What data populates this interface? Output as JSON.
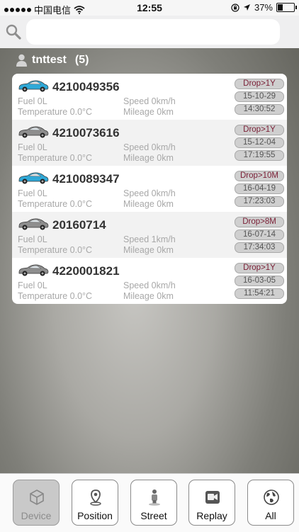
{
  "status_bar": {
    "carrier": "中国电信",
    "time": "12:55",
    "battery": "37%",
    "battery_level": 0.37
  },
  "search": {
    "placeholder": ""
  },
  "group": {
    "name": "tnttest",
    "count": "(5)"
  },
  "devices": [
    {
      "id": "4210049356",
      "car_color": "#2fa9d8",
      "fuel": "Fuel 0L",
      "temperature": "Temperature 0.0°C",
      "speed": "Speed 0km/h",
      "mileage": "Mileage 0km",
      "drop": "Drop>1Y",
      "date": "15-10-29",
      "time": "14:30:52"
    },
    {
      "id": "4210073616",
      "car_color": "#8e8e8e",
      "fuel": "Fuel 0L",
      "temperature": "Temperature 0.0°C",
      "speed": "Speed 0km/h",
      "mileage": "Mileage 0km",
      "drop": "Drop>1Y",
      "date": "15-12-04",
      "time": "17:19:55"
    },
    {
      "id": "4210089347",
      "car_color": "#2fa9d8",
      "fuel": "Fuel 0L",
      "temperature": "Temperature 0.0°C",
      "speed": "Speed 0km/h",
      "mileage": "Mileage 0km",
      "drop": "Drop>10M",
      "date": "16-04-19",
      "time": "17:23:03"
    },
    {
      "id": "20160714",
      "car_color": "#8e8e8e",
      "fuel": "Fuel 0L",
      "temperature": "Temperature 0.0°C",
      "speed": "Speed 1km/h",
      "mileage": "Mileage 0km",
      "drop": "Drop>8M",
      "date": "16-07-14",
      "time": "17:34:03"
    },
    {
      "id": "4220001821",
      "car_color": "#8e8e8e",
      "fuel": "Fuel 0L",
      "temperature": "Temperature 0.0°C",
      "speed": "Speed 0km/h",
      "mileage": "Mileage 0km",
      "drop": "Drop>1Y",
      "date": "16-03-05",
      "time": "11:54:21"
    }
  ],
  "tabs": [
    {
      "label": "Device",
      "icon": "cube-icon",
      "selected": true
    },
    {
      "label": "Position",
      "icon": "location-pin-icon",
      "selected": false
    },
    {
      "label": "Street",
      "icon": "street-person-icon",
      "selected": false
    },
    {
      "label": "Replay",
      "icon": "video-replay-icon",
      "selected": false
    },
    {
      "label": "All",
      "icon": "globe-icon",
      "selected": false
    }
  ],
  "colors": {
    "drop_text": "#7a1e35",
    "pill_bg": "#cfcfcf"
  }
}
